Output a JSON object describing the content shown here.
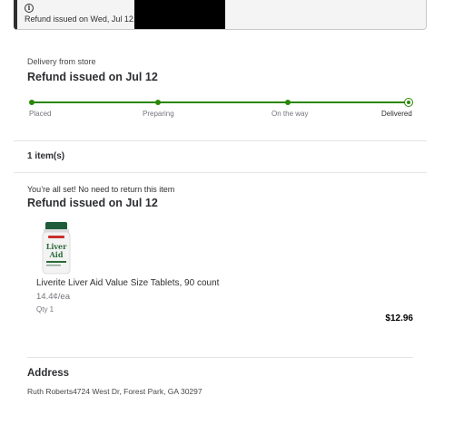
{
  "alert": {
    "icon": "info-icon",
    "message": "Refund issued on Wed, Jul 12."
  },
  "delivery": {
    "subtitle": "Delivery from store",
    "status_heading": "Refund issued on Jul 12",
    "steps": [
      {
        "label": "Placed"
      },
      {
        "label": "Preparing"
      },
      {
        "label": "On the way"
      },
      {
        "label": "Delivered"
      }
    ],
    "current_step": "Delivered",
    "track_color": "#2a8703"
  },
  "items": {
    "count_label": "1 item(s)",
    "note": "You’re all set! No need to return this item",
    "refund_heading": "Refund issued on Jul 12",
    "products": [
      {
        "image_icon": "product-bottle-icon",
        "image_text_line1": "Liver",
        "image_text_line2": "Aid",
        "name": "Liverite Liver Aid Value Size Tablets, 90 count",
        "unit_price": "14.4¢/ea",
        "qty": "Qty 1",
        "price": "$12.96"
      }
    ]
  },
  "address": {
    "title": "Address",
    "line": "Ruth Roberts4724 West Dr, Forest Park, GA 30297"
  }
}
